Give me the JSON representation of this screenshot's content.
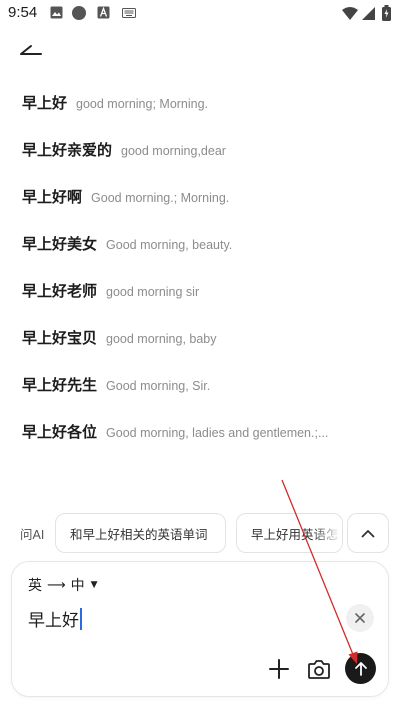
{
  "status_bar": {
    "time": "9:54",
    "left_icons": [
      "image-icon",
      "dot-icon",
      "text-a-icon",
      "keyboard-icon"
    ],
    "right_icons": [
      "wifi-icon",
      "signal-icon",
      "battery-icon"
    ]
  },
  "header": {
    "back_icon": "back-arrow-icon"
  },
  "suggestions": [
    {
      "zh": "早上好",
      "en": "good morning; Morning."
    },
    {
      "zh": "早上好亲爱的",
      "en": "good morning,dear"
    },
    {
      "zh": "早上好啊",
      "en": "Good morning.; Morning."
    },
    {
      "zh": "早上好美女",
      "en": "Good morning, beauty."
    },
    {
      "zh": "早上好老师",
      "en": "good morning sir"
    },
    {
      "zh": "早上好宝贝",
      "en": "good morning, baby"
    },
    {
      "zh": "早上好先生",
      "en": "Good morning, Sir."
    },
    {
      "zh": "早上好各位",
      "en": "Good morning, ladies and gentlemen.;..."
    }
  ],
  "ai_bar": {
    "label": "问AI",
    "chips": [
      "和早上好相关的英语单词",
      "早上好用英语怎"
    ],
    "collapse_icon": "chevron-up-icon"
  },
  "input_card": {
    "lang_from": "英",
    "lang_to": "中",
    "lang_arrow": "⟶",
    "query": "早上好",
    "clear_icon": "close-icon",
    "plus_icon": "plus-icon",
    "camera_icon": "camera-icon",
    "send_icon": "arrow-up-icon"
  },
  "colors": {
    "annotation_arrow": "#d12b2b",
    "send_button": "#1a1a1a",
    "cursor": "#2a6be0"
  }
}
